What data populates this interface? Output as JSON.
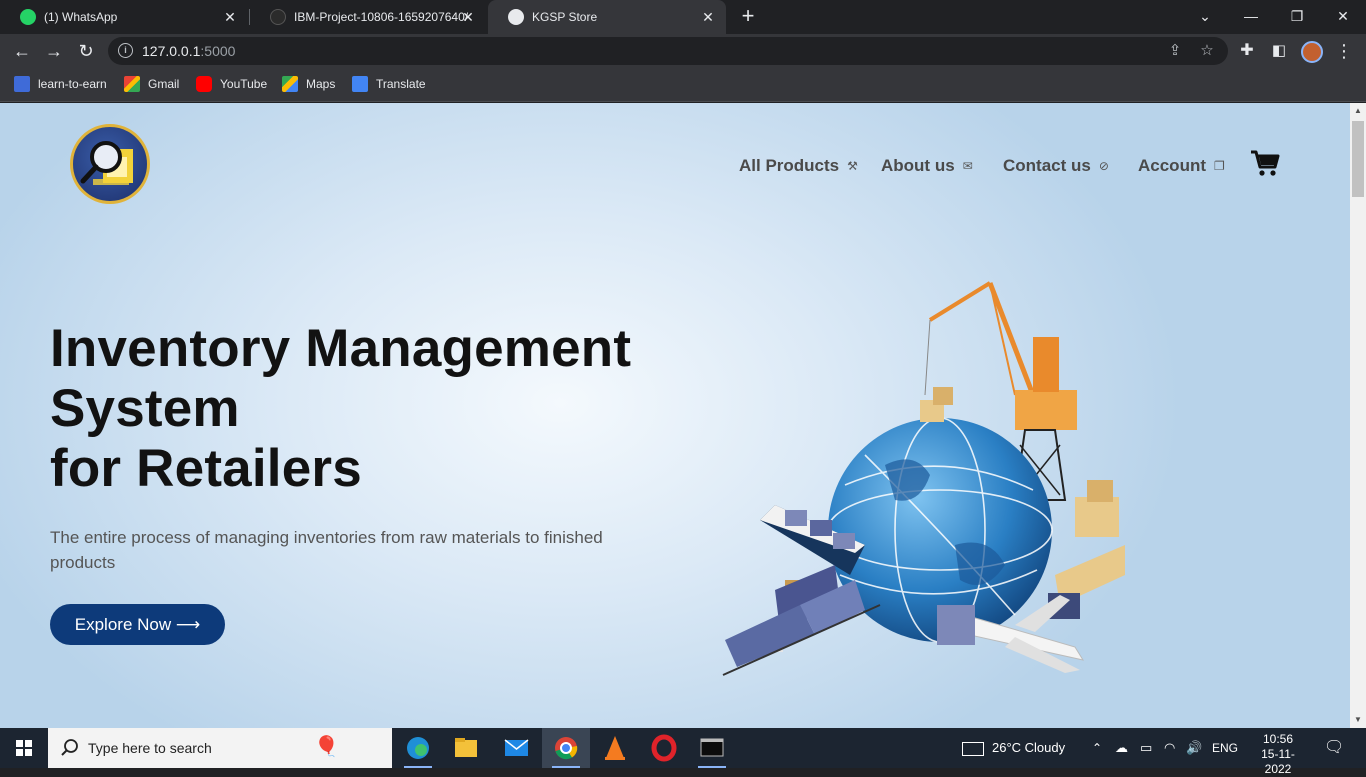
{
  "browser": {
    "tabs": [
      {
        "title": "(1) WhatsApp",
        "active": false
      },
      {
        "title": "IBM-Project-10806-1659207640/",
        "active": false
      },
      {
        "title": "KGSP Store",
        "active": true
      }
    ],
    "url_host": "127.0.0.1",
    "url_port": ":5000",
    "bookmarks": [
      "learn-to-earn",
      "Gmail",
      "YouTube",
      "Maps",
      "Translate"
    ]
  },
  "nav": {
    "all_products": "All Products",
    "about_us": "About us",
    "contact_us": "Contact us",
    "account": "Account"
  },
  "hero": {
    "title_line1": "Inventory Management",
    "title_line2": "System",
    "title_line3": "for Retailers",
    "subtitle": "The entire process of managing inventories from raw materials to finished products",
    "cta": "Explore Now ⟶"
  },
  "taskbar": {
    "search_placeholder": "Type here to search",
    "weather": "26°C  Cloudy",
    "language": "ENG",
    "time": "10:56",
    "date": "15-11-2022"
  },
  "colors": {
    "cta_bg": "#0d3a7a",
    "page_bg": "#c9dff0",
    "chrome_dark": "#202124"
  }
}
